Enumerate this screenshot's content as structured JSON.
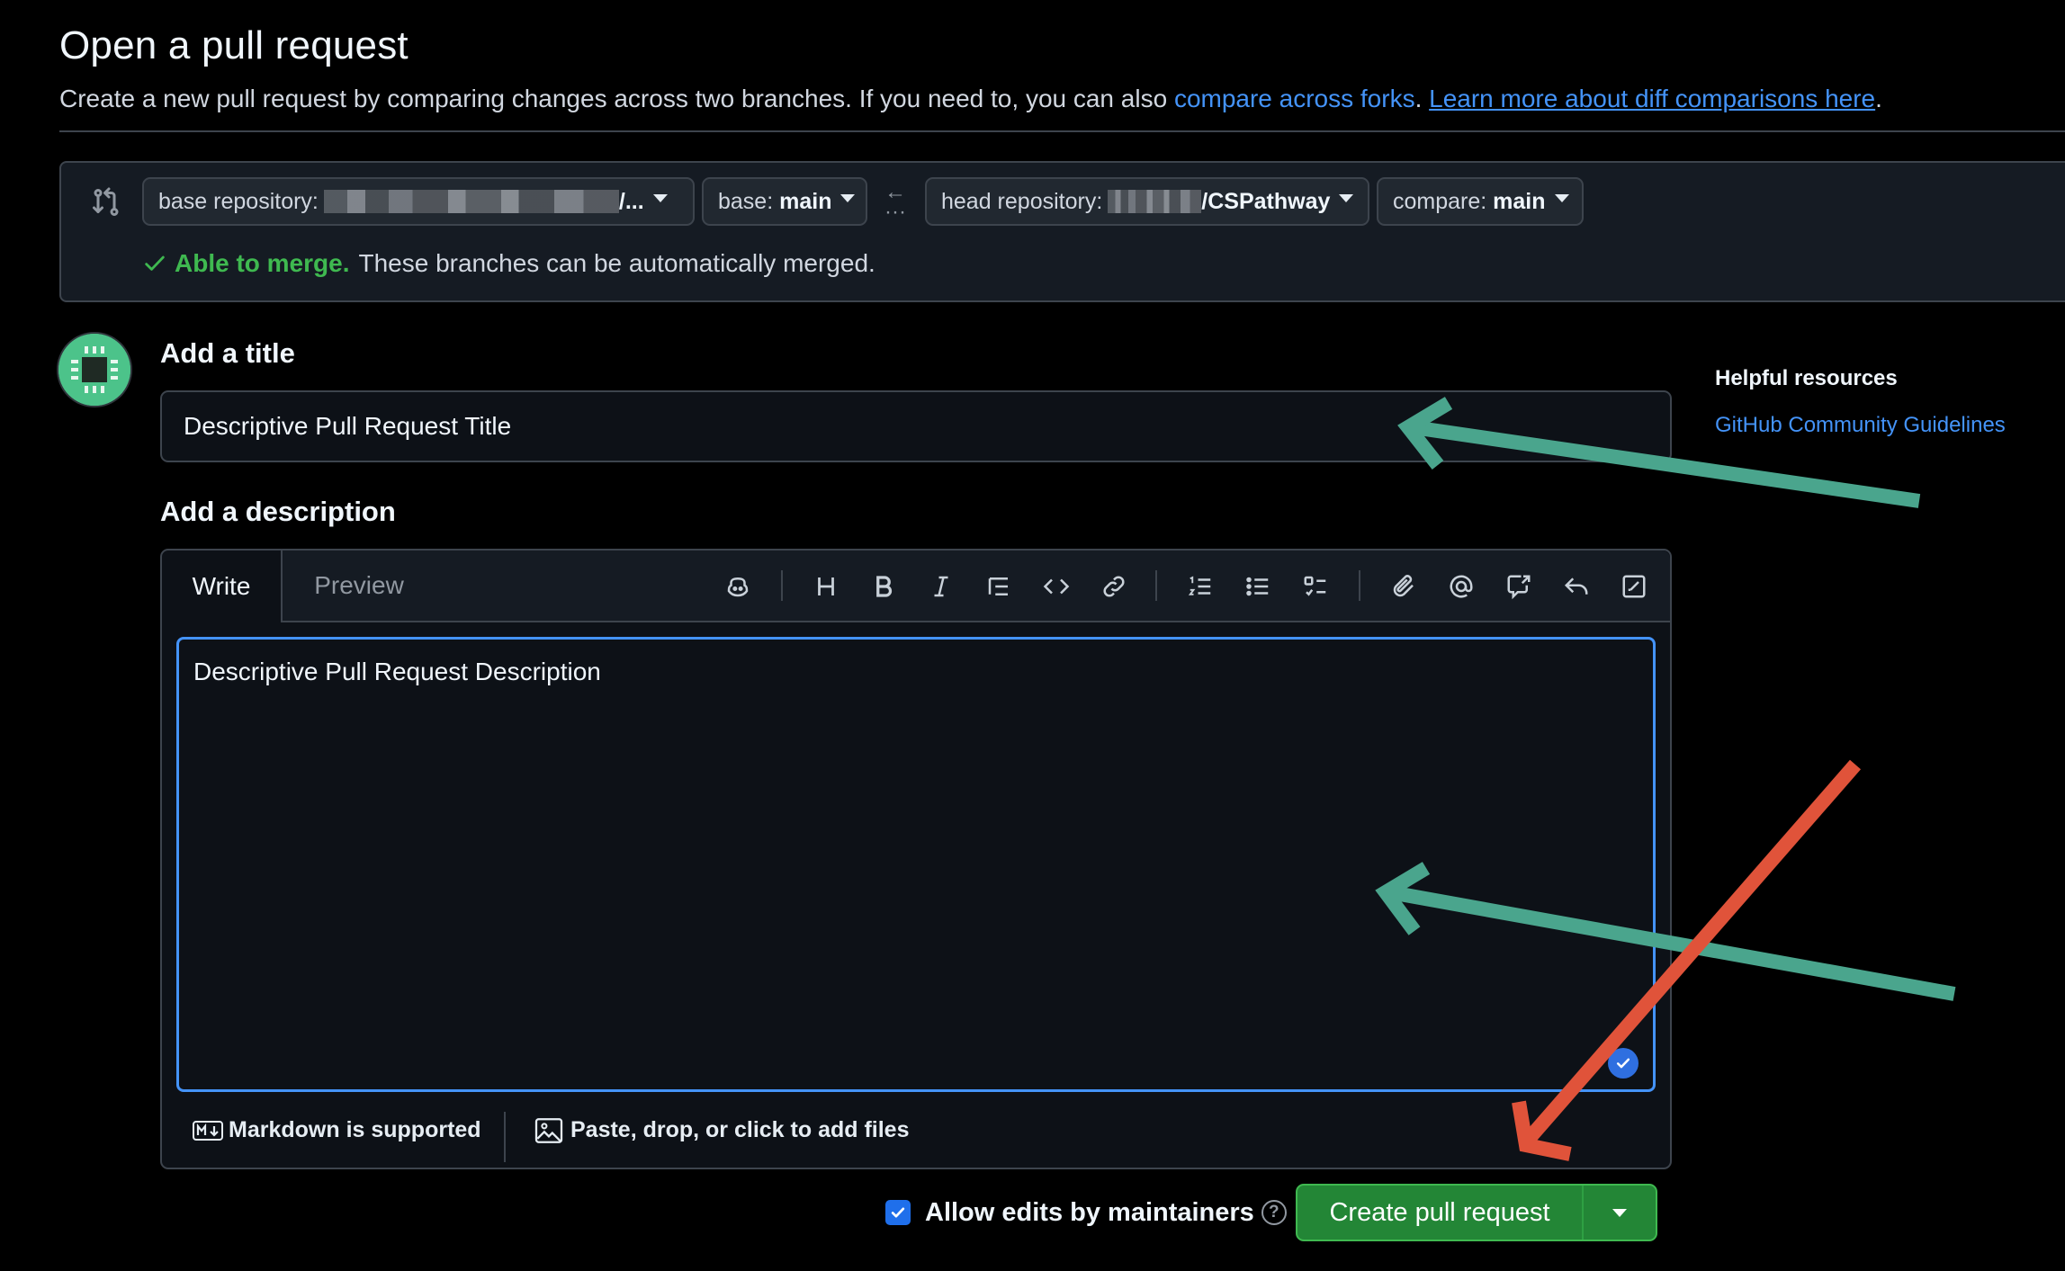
{
  "header": {
    "title": "Open a pull request",
    "subtitle_text": "Create a new pull request by comparing changes across two branches. If you need to, you can also ",
    "compare_forks_link": "compare across forks",
    "subtitle_sep": ". ",
    "learn_more_link": "Learn more about diff comparisons here",
    "subtitle_end": "."
  },
  "compare": {
    "base_repo_label": "base repository:",
    "base_repo_value": "/...",
    "base_label": "base:",
    "base_value": "main",
    "head_repo_label": "head repository:",
    "head_repo_value": "/CSPathway",
    "compare_label": "compare:",
    "compare_value": "main",
    "merge_status": "Able to merge.",
    "merge_message": "These branches can be automatically merged."
  },
  "form": {
    "title_label": "Add a title",
    "title_value": "Descriptive Pull Request Title",
    "description_label": "Add a description",
    "tab_write": "Write",
    "tab_preview": "Preview",
    "description_value": "Descriptive Pull Request Description",
    "markdown_note": "Markdown is supported",
    "attach_note": "Paste, drop, or click to add files"
  },
  "toolbar": {
    "icons": [
      "copilot-icon",
      "heading-icon",
      "bold-icon",
      "italic-icon",
      "quote-icon",
      "code-icon",
      "link-icon",
      "ordered-list-icon",
      "unordered-list-icon",
      "task-list-icon",
      "attach-icon",
      "mention-icon",
      "cross-reference-icon",
      "saved-reply-icon",
      "fullscreen-icon"
    ]
  },
  "sidebar": {
    "title": "Helpful resources",
    "link": "GitHub Community Guidelines"
  },
  "footer": {
    "allow_edits": "Allow edits by maintainers",
    "allow_edits_checked": true,
    "create_button": "Create pull request"
  },
  "colors": {
    "accent_blue": "#4493f8",
    "success_green": "#3fb950",
    "button_green": "#238636",
    "annotation_teal": "#4aa58d",
    "annotation_red": "#e0533a"
  }
}
